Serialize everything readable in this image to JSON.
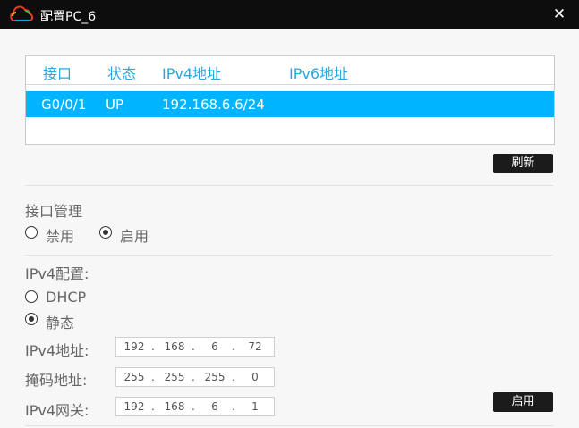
{
  "window": {
    "title": "配置PC_6",
    "close_glyph": "✕"
  },
  "table": {
    "headers": [
      "接口",
      "状态",
      "IPv4地址",
      "IPv6地址"
    ],
    "rows": [
      {
        "iface": "G0/0/1",
        "status": "UP",
        "ipv4": "192.168.6.6/24",
        "ipv6": ""
      }
    ]
  },
  "refresh_button": "刷新",
  "interface_mgmt": {
    "label": "接口管理",
    "options": [
      "禁用",
      "启用"
    ],
    "selected": "启用"
  },
  "ipv4_config": {
    "label": "IPv4配置:",
    "options": [
      "DHCP",
      "静态"
    ],
    "selected": "静态",
    "address_label": "IPv4地址:",
    "address": [
      "192",
      "168",
      "6",
      "72"
    ],
    "mask_label": "掩码地址:",
    "mask": [
      "255",
      "255",
      "255",
      "0"
    ],
    "gateway_label": "IPv4网关:",
    "gateway": [
      "192",
      "168",
      "6",
      "1"
    ]
  },
  "apply_button": "启用",
  "colors": {
    "accent": "#00b4ff",
    "header_text": "#29a8e0",
    "titlebar": "#0d0d0d"
  },
  "icons": [
    "cloud-logo-icon",
    "close-icon"
  ]
}
